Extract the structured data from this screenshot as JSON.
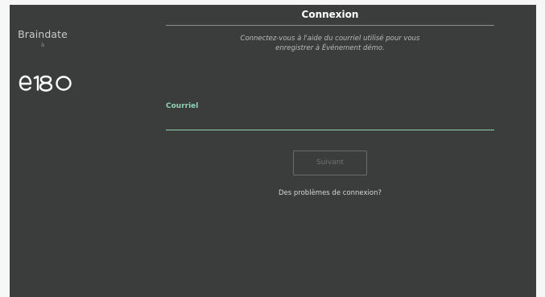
{
  "sidebar": {
    "brand_name": "Braindate",
    "brand_sub": "à",
    "logo_icon": "e180-logo"
  },
  "main": {
    "title": "Connexion",
    "instructions_line1": "Connectez-vous à l'aide du courriel utilisé pour vous",
    "instructions_line2": "enregistrer à Événement démo.",
    "email_label": "Courriel",
    "email_value": "",
    "next_label": "Suivant",
    "help_link": "Des problèmes de connexion?"
  },
  "colors": {
    "background": "#3b3d3c",
    "accent": "#8fd2b3",
    "text": "#ffffff"
  }
}
